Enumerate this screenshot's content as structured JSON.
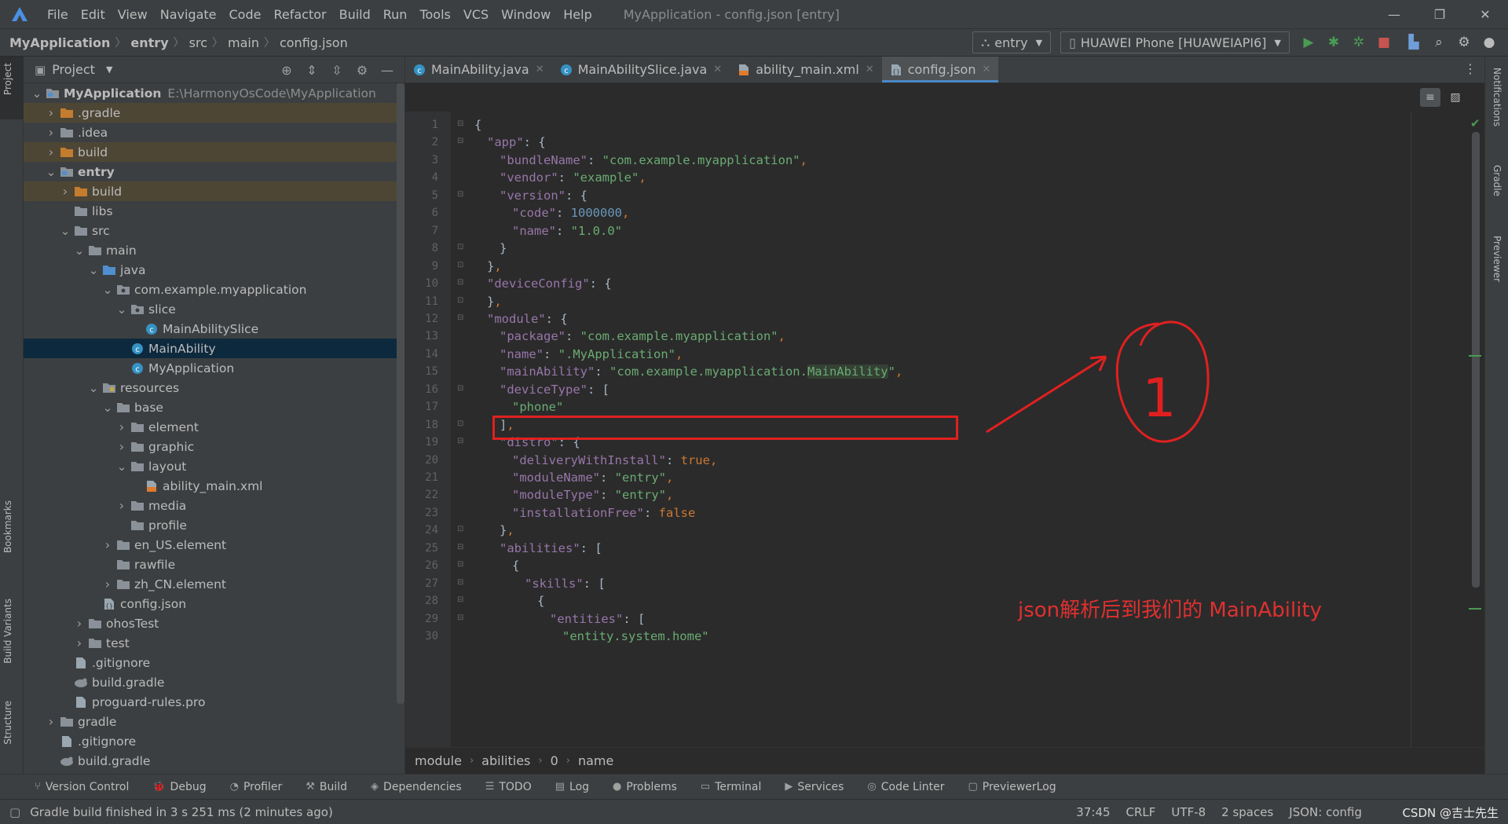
{
  "menubar": {
    "items": [
      "File",
      "Edit",
      "View",
      "Navigate",
      "Code",
      "Refactor",
      "Build",
      "Run",
      "Tools",
      "VCS",
      "Window",
      "Help"
    ],
    "window_title": "MyApplication - config.json [entry]"
  },
  "navbar": {
    "crumbs": [
      "MyApplication",
      "entry",
      "src",
      "main",
      "config.json"
    ],
    "run_config": "entry",
    "device": "HUAWEI Phone [HUAWEIAPI6]"
  },
  "stripes": {
    "left_top": "Project",
    "left_bookmarks": "Bookmarks",
    "left_build_variants": "Build Variants",
    "left_structure": "Structure",
    "right_notifications": "Notifications",
    "right_gradle": "Gradle",
    "right_previewer": "Previewer"
  },
  "project": {
    "title": "Project",
    "tree": [
      {
        "depth": 0,
        "arrow": "down",
        "icon": "module-folder",
        "name": "MyApplication",
        "path": "E:\\HarmonyOsCode\\MyApplication",
        "bold": true,
        "state": ""
      },
      {
        "depth": 1,
        "arrow": "right",
        "icon": "orange-folder",
        "name": ".gradle",
        "state": "excluded"
      },
      {
        "depth": 1,
        "arrow": "right",
        "icon": "gray-folder",
        "name": ".idea",
        "state": ""
      },
      {
        "depth": 1,
        "arrow": "right",
        "icon": "orange-folder",
        "name": "build",
        "state": "excluded"
      },
      {
        "depth": 1,
        "arrow": "down",
        "icon": "module-folder",
        "name": "entry",
        "bold": true,
        "state": ""
      },
      {
        "depth": 2,
        "arrow": "right",
        "icon": "orange-folder",
        "name": "build",
        "state": "excluded"
      },
      {
        "depth": 2,
        "arrow": "",
        "icon": "gray-folder",
        "name": "libs",
        "state": ""
      },
      {
        "depth": 2,
        "arrow": "down",
        "icon": "gray-folder",
        "name": "src",
        "state": ""
      },
      {
        "depth": 3,
        "arrow": "down",
        "icon": "gray-folder",
        "name": "main",
        "state": ""
      },
      {
        "depth": 4,
        "arrow": "down",
        "icon": "blue-folder",
        "name": "java",
        "state": ""
      },
      {
        "depth": 5,
        "arrow": "down",
        "icon": "package",
        "name": "com.example.myapplication",
        "state": ""
      },
      {
        "depth": 6,
        "arrow": "down",
        "icon": "package",
        "name": "slice",
        "state": ""
      },
      {
        "depth": 7,
        "arrow": "",
        "icon": "class",
        "name": "MainAbilitySlice",
        "state": ""
      },
      {
        "depth": 6,
        "arrow": "",
        "icon": "class",
        "name": "MainAbility",
        "state": "selected"
      },
      {
        "depth": 6,
        "arrow": "",
        "icon": "class",
        "name": "MyApplication",
        "state": ""
      },
      {
        "depth": 4,
        "arrow": "down",
        "icon": "resource-folder",
        "name": "resources",
        "state": ""
      },
      {
        "depth": 5,
        "arrow": "down",
        "icon": "gray-folder",
        "name": "base",
        "state": ""
      },
      {
        "depth": 6,
        "arrow": "right",
        "icon": "gray-folder",
        "name": "element",
        "state": ""
      },
      {
        "depth": 6,
        "arrow": "right",
        "icon": "gray-folder",
        "name": "graphic",
        "state": ""
      },
      {
        "depth": 6,
        "arrow": "down",
        "icon": "gray-folder",
        "name": "layout",
        "state": ""
      },
      {
        "depth": 7,
        "arrow": "",
        "icon": "xml-file",
        "name": "ability_main.xml",
        "state": ""
      },
      {
        "depth": 6,
        "arrow": "right",
        "icon": "gray-folder",
        "name": "media",
        "state": ""
      },
      {
        "depth": 6,
        "arrow": "",
        "icon": "gray-folder",
        "name": "profile",
        "state": ""
      },
      {
        "depth": 5,
        "arrow": "right",
        "icon": "gray-folder",
        "name": "en_US.element",
        "state": ""
      },
      {
        "depth": 5,
        "arrow": "",
        "icon": "gray-folder",
        "name": "rawfile",
        "state": ""
      },
      {
        "depth": 5,
        "arrow": "right",
        "icon": "gray-folder",
        "name": "zh_CN.element",
        "state": ""
      },
      {
        "depth": 4,
        "arrow": "",
        "icon": "json-file",
        "name": "config.json",
        "state": ""
      },
      {
        "depth": 3,
        "arrow": "right",
        "icon": "gray-folder",
        "name": "ohosTest",
        "state": ""
      },
      {
        "depth": 3,
        "arrow": "right",
        "icon": "gray-folder",
        "name": "test",
        "state": ""
      },
      {
        "depth": 2,
        "arrow": "",
        "icon": "text-file",
        "name": ".gitignore",
        "state": ""
      },
      {
        "depth": 2,
        "arrow": "",
        "icon": "gradle-file",
        "name": "build.gradle",
        "state": ""
      },
      {
        "depth": 2,
        "arrow": "",
        "icon": "text-file",
        "name": "proguard-rules.pro",
        "state": ""
      },
      {
        "depth": 1,
        "arrow": "right",
        "icon": "gray-folder",
        "name": "gradle",
        "state": ""
      },
      {
        "depth": 1,
        "arrow": "",
        "icon": "text-file",
        "name": ".gitignore",
        "state": ""
      },
      {
        "depth": 1,
        "arrow": "",
        "icon": "gradle-file",
        "name": "build.gradle",
        "state": ""
      }
    ]
  },
  "editor": {
    "tabs": [
      {
        "label": "MainAbility.java",
        "icon": "class",
        "active": false
      },
      {
        "label": "MainAbilitySlice.java",
        "icon": "class",
        "active": false
      },
      {
        "label": "ability_main.xml",
        "icon": "xml-file",
        "active": false
      },
      {
        "label": "config.json",
        "icon": "json-file",
        "active": true
      }
    ],
    "lines": [
      {
        "n": 1,
        "indent": 0,
        "fold": "open",
        "tokens": [
          [
            "p",
            "{"
          ]
        ]
      },
      {
        "n": 2,
        "indent": 1,
        "fold": "open",
        "tokens": [
          [
            "k",
            "\"app\""
          ],
          [
            "p",
            ": {"
          ]
        ]
      },
      {
        "n": 3,
        "indent": 2,
        "fold": "",
        "tokens": [
          [
            "k",
            "\"bundleName\""
          ],
          [
            "p",
            ": "
          ],
          [
            "s2",
            "\"com.example.myapplication\""
          ],
          [
            "b",
            ","
          ]
        ]
      },
      {
        "n": 4,
        "indent": 2,
        "fold": "",
        "tokens": [
          [
            "k",
            "\"vendor\""
          ],
          [
            "p",
            ": "
          ],
          [
            "s2",
            "\"example\""
          ],
          [
            "b",
            ","
          ]
        ]
      },
      {
        "n": 5,
        "indent": 2,
        "fold": "open",
        "tokens": [
          [
            "k",
            "\"version\""
          ],
          [
            "p",
            ": {"
          ]
        ]
      },
      {
        "n": 6,
        "indent": 3,
        "fold": "",
        "tokens": [
          [
            "k",
            "\"code\""
          ],
          [
            "p",
            ": "
          ],
          [
            "n",
            "1000000"
          ],
          [
            "b",
            ","
          ]
        ]
      },
      {
        "n": 7,
        "indent": 3,
        "fold": "",
        "tokens": [
          [
            "k",
            "\"name\""
          ],
          [
            "p",
            ": "
          ],
          [
            "s2",
            "\"1.0.0\""
          ]
        ]
      },
      {
        "n": 8,
        "indent": 2,
        "fold": "close",
        "tokens": [
          [
            "p",
            "}"
          ]
        ]
      },
      {
        "n": 9,
        "indent": 1,
        "fold": "close",
        "tokens": [
          [
            "p",
            "}"
          ],
          [
            "b",
            ","
          ]
        ]
      },
      {
        "n": 10,
        "indent": 1,
        "fold": "open",
        "tokens": [
          [
            "k",
            "\"deviceConfig\""
          ],
          [
            "p",
            ": {"
          ]
        ]
      },
      {
        "n": 11,
        "indent": 1,
        "fold": "close",
        "tokens": [
          [
            "p",
            "}"
          ],
          [
            "b",
            ","
          ]
        ]
      },
      {
        "n": 12,
        "indent": 1,
        "fold": "open",
        "tokens": [
          [
            "k",
            "\"module\""
          ],
          [
            "p",
            ": {"
          ]
        ]
      },
      {
        "n": 13,
        "indent": 2,
        "fold": "",
        "tokens": [
          [
            "k",
            "\"package\""
          ],
          [
            "p",
            ": "
          ],
          [
            "s2",
            "\"com.example.myapplication\""
          ],
          [
            "b",
            ","
          ]
        ]
      },
      {
        "n": 14,
        "indent": 2,
        "fold": "",
        "tokens": [
          [
            "k",
            "\"name\""
          ],
          [
            "p",
            ": "
          ],
          [
            "s2",
            "\".MyApplication\""
          ],
          [
            "b",
            ","
          ]
        ]
      },
      {
        "n": 15,
        "indent": 2,
        "fold": "",
        "tokens": [
          [
            "k",
            "\"mainAbility\""
          ],
          [
            "p",
            ": "
          ],
          [
            "s2",
            "\"com.example.myapplication."
          ],
          [
            "s2 hl",
            "MainAbility"
          ],
          [
            "s2",
            "\""
          ],
          [
            "b",
            ","
          ]
        ]
      },
      {
        "n": 16,
        "indent": 2,
        "fold": "open",
        "tokens": [
          [
            "k",
            "\"deviceType\""
          ],
          [
            "p",
            ": ["
          ]
        ]
      },
      {
        "n": 17,
        "indent": 3,
        "fold": "",
        "tokens": [
          [
            "s2",
            "\"phone\""
          ]
        ]
      },
      {
        "n": 18,
        "indent": 2,
        "fold": "close",
        "tokens": [
          [
            "p",
            "]"
          ],
          [
            "b",
            ","
          ]
        ]
      },
      {
        "n": 19,
        "indent": 2,
        "fold": "open",
        "tokens": [
          [
            "k",
            "\"distro\""
          ],
          [
            "p",
            ": {"
          ]
        ]
      },
      {
        "n": 20,
        "indent": 3,
        "fold": "",
        "tokens": [
          [
            "k",
            "\"deliveryWithInstall\""
          ],
          [
            "p",
            ": "
          ],
          [
            "b",
            "true,"
          ]
        ]
      },
      {
        "n": 21,
        "indent": 3,
        "fold": "",
        "tokens": [
          [
            "k",
            "\"moduleName\""
          ],
          [
            "p",
            ": "
          ],
          [
            "s2",
            "\"entry\""
          ],
          [
            "b",
            ","
          ]
        ]
      },
      {
        "n": 22,
        "indent": 3,
        "fold": "",
        "tokens": [
          [
            "k",
            "\"moduleType\""
          ],
          [
            "p",
            ": "
          ],
          [
            "s2",
            "\"entry\""
          ],
          [
            "b",
            ","
          ]
        ]
      },
      {
        "n": 23,
        "indent": 3,
        "fold": "",
        "tokens": [
          [
            "k",
            "\"installationFree\""
          ],
          [
            "p",
            ": "
          ],
          [
            "b",
            "false"
          ]
        ]
      },
      {
        "n": 24,
        "indent": 2,
        "fold": "close",
        "tokens": [
          [
            "p",
            "}"
          ],
          [
            "b",
            ","
          ]
        ]
      },
      {
        "n": 25,
        "indent": 2,
        "fold": "open",
        "tokens": [
          [
            "k",
            "\"abilities\""
          ],
          [
            "p",
            ": ["
          ]
        ]
      },
      {
        "n": 26,
        "indent": 3,
        "fold": "open",
        "tokens": [
          [
            "p",
            "{"
          ]
        ]
      },
      {
        "n": 27,
        "indent": 4,
        "fold": "open",
        "tokens": [
          [
            "k",
            "\"skills\""
          ],
          [
            "p",
            ": ["
          ]
        ]
      },
      {
        "n": 28,
        "indent": 5,
        "fold": "open",
        "tokens": [
          [
            "p",
            "{"
          ]
        ]
      },
      {
        "n": 29,
        "indent": 6,
        "fold": "open",
        "tokens": [
          [
            "k",
            "\"entities\""
          ],
          [
            "p",
            ": ["
          ]
        ]
      },
      {
        "n": 30,
        "indent": 7,
        "fold": "",
        "tokens": [
          [
            "s2",
            "\"entity.system.home\""
          ]
        ]
      }
    ],
    "breadcrumbs": [
      "module",
      "abilities",
      "0",
      "name"
    ]
  },
  "annotation": {
    "circle_label": "1",
    "note": "json解析后到我们的 MainAbility",
    "color": "#e02020"
  },
  "toolwindows": [
    {
      "icon": "vcs-icon",
      "glyph": "⑂",
      "label": "Version Control"
    },
    {
      "icon": "debug-icon",
      "glyph": "🐞",
      "label": "Debug"
    },
    {
      "icon": "profiler-icon",
      "glyph": "◔",
      "label": "Profiler"
    },
    {
      "icon": "build-icon",
      "glyph": "⚒",
      "label": "Build"
    },
    {
      "icon": "dependencies-icon",
      "glyph": "◈",
      "label": "Dependencies"
    },
    {
      "icon": "todo-icon",
      "glyph": "☰",
      "label": "TODO"
    },
    {
      "icon": "log-icon",
      "glyph": "▤",
      "label": "Log"
    },
    {
      "icon": "problems-icon",
      "glyph": "●",
      "label": "Problems"
    },
    {
      "icon": "terminal-icon",
      "glyph": "▭",
      "label": "Terminal"
    },
    {
      "icon": "services-icon",
      "glyph": "▶",
      "label": "Services"
    },
    {
      "icon": "code-linter-icon",
      "glyph": "◎",
      "label": "Code Linter"
    },
    {
      "icon": "previewer-log-icon",
      "glyph": "▢",
      "label": "PreviewerLog"
    }
  ],
  "statusbar": {
    "message": "Gradle build finished in 3 s 251 ms (2 minutes ago)",
    "position": "37:45",
    "line_sep": "CRLF",
    "encoding": "UTF-8",
    "indent": "2 spaces",
    "schema": "JSON: config",
    "watermark": "CSDN @吉士先生"
  }
}
